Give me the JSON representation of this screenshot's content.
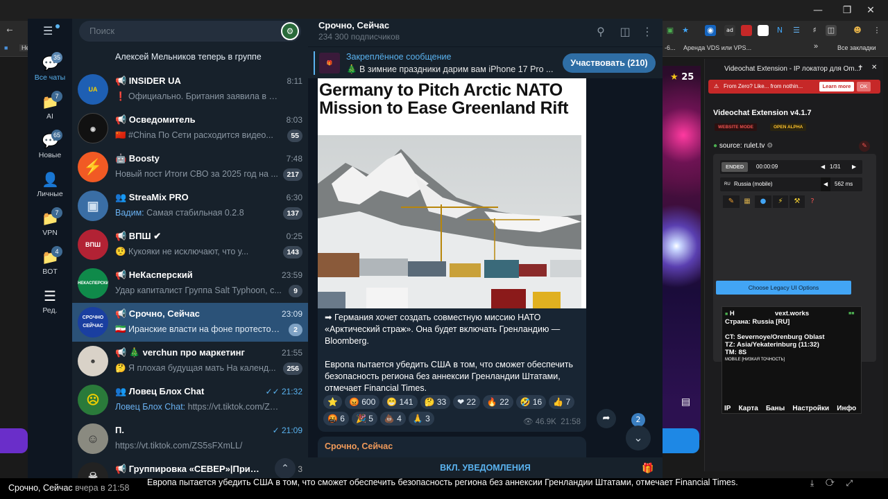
{
  "browser": {
    "bookmarks": {
      "item1": "Не",
      "item2": "-6...",
      "item3": "Аренда VDS или VPS...",
      "more": "»",
      "all": "Все закладки"
    }
  },
  "space": {
    "star_count": "25"
  },
  "extension": {
    "header": "Videochat Extension - IP локатор для Om...",
    "banner": "From Zero? Like... from nothin...",
    "learn_more": "Learn more",
    "ok": "OK",
    "title": "Videochat Extension v4.1.7",
    "badge_mode": "WEBSITE MODE",
    "badge_alpha": "OPEN ALPHA",
    "source": "source: rulet.tv",
    "status": "ENDED",
    "timer": "00:00:09",
    "counter": "1/31",
    "country": "Russia (mobile)",
    "latency": "562 ms",
    "legacy_button": "Choose Legacy UI Options",
    "info_header": "H",
    "info_site": "vext.works",
    "info_country": "Страна: Russia [RU]",
    "info_ct": "CT: Severnoye/Orenburg Oblast",
    "info_tz": "TZ: Asia/Yekaterinburg (11:32)",
    "info_tm": "TM: 8S",
    "info_mobile": "MOBILE [НИЗКАЯ ТОЧНОСТЬ]",
    "tabs": [
      "IP",
      "Карта",
      "Баны",
      "Настройки",
      "Инфо"
    ]
  },
  "telegram": {
    "search_placeholder": "Поиск",
    "rail": [
      {
        "label": "Все чаты",
        "count": "35"
      },
      {
        "label": "AI",
        "count": "7"
      },
      {
        "label": "Новые",
        "count": "65"
      },
      {
        "label": "Личные",
        "count": ""
      },
      {
        "label": "VPN",
        "count": "7"
      },
      {
        "label": "BOT",
        "count": "4"
      },
      {
        "label": "Ред.",
        "count": ""
      }
    ],
    "top_partial": "Алексей Мельников теперь в группе",
    "chats": [
      {
        "name": "📢 INSIDER UA",
        "time": "8:11",
        "preview": "❗ Официально. Британия заявила в воскре...",
        "unread": ""
      },
      {
        "name": "📢 Осведомитель",
        "time": "8:03",
        "preview": "🇨🇳 #China По Сети расходится видео...",
        "unread": "55"
      },
      {
        "name": "🤖 Boosty",
        "time": "7:48",
        "preview": "Новый пост Итоги СВО за 2025 год на ...",
        "unread": "217"
      },
      {
        "name": "👥 StreaMix PRO",
        "time": "6:30",
        "who": "Вадим:",
        "preview": " Самая стабильная 0.2.8",
        "unread": "137"
      },
      {
        "name": "📢 ВПШ ✔",
        "time": "0:25",
        "preview": "🤨 Кукояки не исключают, что у...",
        "unread": "143"
      },
      {
        "name": "📢 НеКасперский",
        "time": "23:59",
        "preview": "Удар капиталист Группа Salt Typhoon, с...",
        "unread": "9"
      },
      {
        "name": "📢 Срочно, Сейчас",
        "time": "23:09",
        "preview": "🇮🇷 Иранские власти на фоне протестов ...",
        "unread": "2"
      },
      {
        "name": "📢 🎄 verchun про маркетинг",
        "time": "21:55",
        "preview": "🤔 Я плохая будущая мать  На календ...",
        "unread": "256"
      },
      {
        "name": "👥 Ловец Блох Chat",
        "time": "✓✓ 21:32",
        "who": "Ловец Блох Chat:",
        "preview": " https://vt.tiktok.com/ZS...",
        "unread": ""
      },
      {
        "name": "П.",
        "time": "✓ 21:09",
        "preview": "https://vt.tiktok.com/ZS5sFXmLL/",
        "unread": ""
      },
      {
        "name": "📢 Группировка «СЕВЕР»|Приграничье",
        "time": "",
        "preview": "",
        "unread": "3"
      }
    ],
    "chat": {
      "title": "Срочно, Сейчас",
      "subscribers": "234 300 подписчиков",
      "pinned_label": "Закреплённое сообщение",
      "pinned_text": "🎄 В зимние праздники дарим вам iPhone 17 Pro ...",
      "join_button": "Участвовать (210)",
      "headline": "Germany to Pitch Arctic NATO Mission to Ease Greenland Rift",
      "paragraph1": "➡ Германия хочет создать совместную миссию НАТО «Арктический страж». Она будет включать Гренландию — Bloomberg.",
      "paragraph2": "Европа пытается убедить США в том, что сможет обеспечить безопасность региона без аннексии Гренландии Штатами, отмечает Financial Times.",
      "reactions_row1": [
        "⭐",
        "😡 600",
        "😁 141",
        "🤔 33",
        "❤ 22",
        "🔥 22",
        "🤣 16",
        "👍 7"
      ],
      "reactions_row2": [
        "🤬 6",
        "🎉 5",
        "💩 4",
        "🙏 3"
      ],
      "views": "👁 46.9K",
      "post_time": "21:58",
      "down_badge": "2",
      "next_post_author": "Срочно, Сейчас",
      "notifications": "ВКЛ. УВЕДОМЛЕНИЯ"
    }
  },
  "caption": {
    "left_title": "Срочно, Сейчас",
    "left_time": "вчера в 21:58",
    "main": "Европа пытается убедить США в том, что сможет обеспечить безопасность региона без аннексии Гренландии Штатами, отмечает Financial Times."
  }
}
